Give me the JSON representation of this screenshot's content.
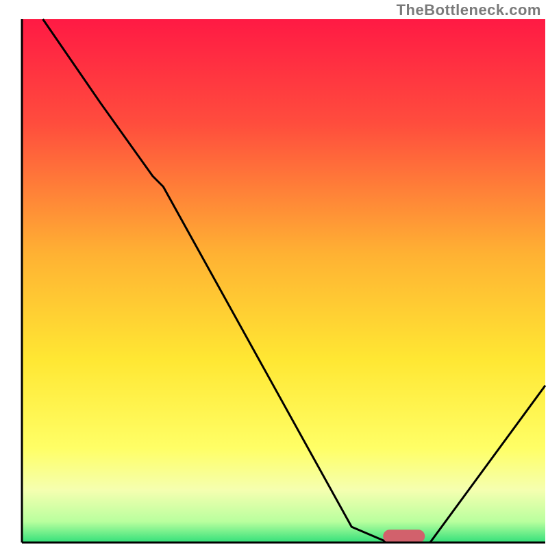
{
  "watermark": "TheBottleneck.com",
  "chart_data": {
    "type": "line",
    "title": "",
    "xlabel": "",
    "ylabel": "",
    "xlim": [
      0,
      100
    ],
    "ylim": [
      0,
      100
    ],
    "axes_visible": false,
    "gridlines": false,
    "legend": false,
    "background_gradient": {
      "type": "vertical",
      "stops": [
        {
          "offset": 0.0,
          "color": "#ff1a44"
        },
        {
          "offset": 0.2,
          "color": "#ff4d3d"
        },
        {
          "offset": 0.45,
          "color": "#ffb233"
        },
        {
          "offset": 0.65,
          "color": "#ffe733"
        },
        {
          "offset": 0.82,
          "color": "#ffff66"
        },
        {
          "offset": 0.9,
          "color": "#f5ffb0"
        },
        {
          "offset": 0.96,
          "color": "#b9ff9e"
        },
        {
          "offset": 1.0,
          "color": "#33e07a"
        }
      ]
    },
    "series": [
      {
        "name": "bottleneck-curve",
        "color": "#000000",
        "x": [
          4,
          15,
          25,
          27,
          63,
          70,
          78,
          100
        ],
        "y": [
          100,
          84,
          70,
          68,
          3,
          0,
          0,
          30
        ]
      }
    ],
    "annotations": [
      {
        "name": "optimal-marker",
        "type": "capsule",
        "x_center": 73,
        "y_center": 1.2,
        "width": 8,
        "height": 2.5,
        "color": "#d2616c"
      }
    ],
    "border": {
      "left": true,
      "bottom": true,
      "right": false,
      "top": false,
      "color": "#000000",
      "width": 3
    }
  }
}
